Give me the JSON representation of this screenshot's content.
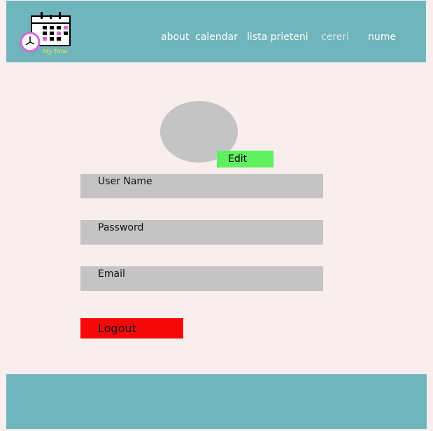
{
  "colors": {
    "page_background": "#f8eeee",
    "header_footer": "#6fb5bb",
    "input_fields": "#c4c4c4",
    "avatar": "#c4c4c4",
    "edit_button": "#5ef05e",
    "logout_button": "#f50a0a",
    "nav_text": "#ffffff",
    "nav_text_muted": "#d8e4e6"
  },
  "header": {
    "logo_icon": "calendar-clock-logo-icon",
    "logo_text": "My Time",
    "nav": {
      "about": "about",
      "calendar": "calendar",
      "lista_prieteni": "lista prieteni",
      "cereri": "cereri",
      "nume": "nume"
    }
  },
  "profile": {
    "avatar_icon": "avatar-placeholder-icon",
    "edit_label": "Edit",
    "fields": {
      "username": "User Name",
      "password": "Password",
      "email": "Email"
    },
    "logout_label": "Logout"
  }
}
